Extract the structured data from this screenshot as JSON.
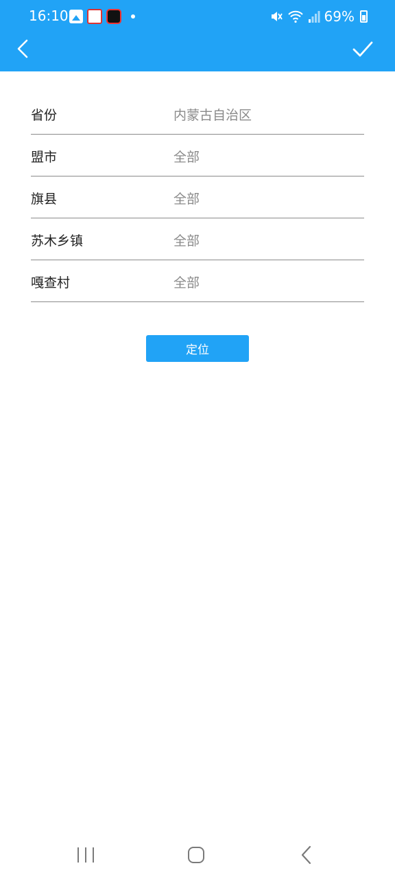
{
  "status_bar": {
    "time": "16:10",
    "battery": "69%",
    "icons": [
      "gallery-icon",
      "app-icon",
      "screen-record-icon",
      "dot-icon",
      "mute-icon",
      "wifi-icon",
      "signal-icon",
      "battery-icon"
    ]
  },
  "header": {
    "back_icon": "chevron-left-icon",
    "confirm_icon": "checkmark-icon",
    "background_color": "#21a3f6"
  },
  "form": {
    "rows": [
      {
        "label": "省份",
        "value": "内蒙古自治区"
      },
      {
        "label": "盟市",
        "value": "全部"
      },
      {
        "label": "旗县",
        "value": "全部"
      },
      {
        "label": "苏木乡镇",
        "value": "全部"
      },
      {
        "label": "嘎查村",
        "value": "全部"
      }
    ]
  },
  "actions": {
    "locate_label": "定位"
  }
}
